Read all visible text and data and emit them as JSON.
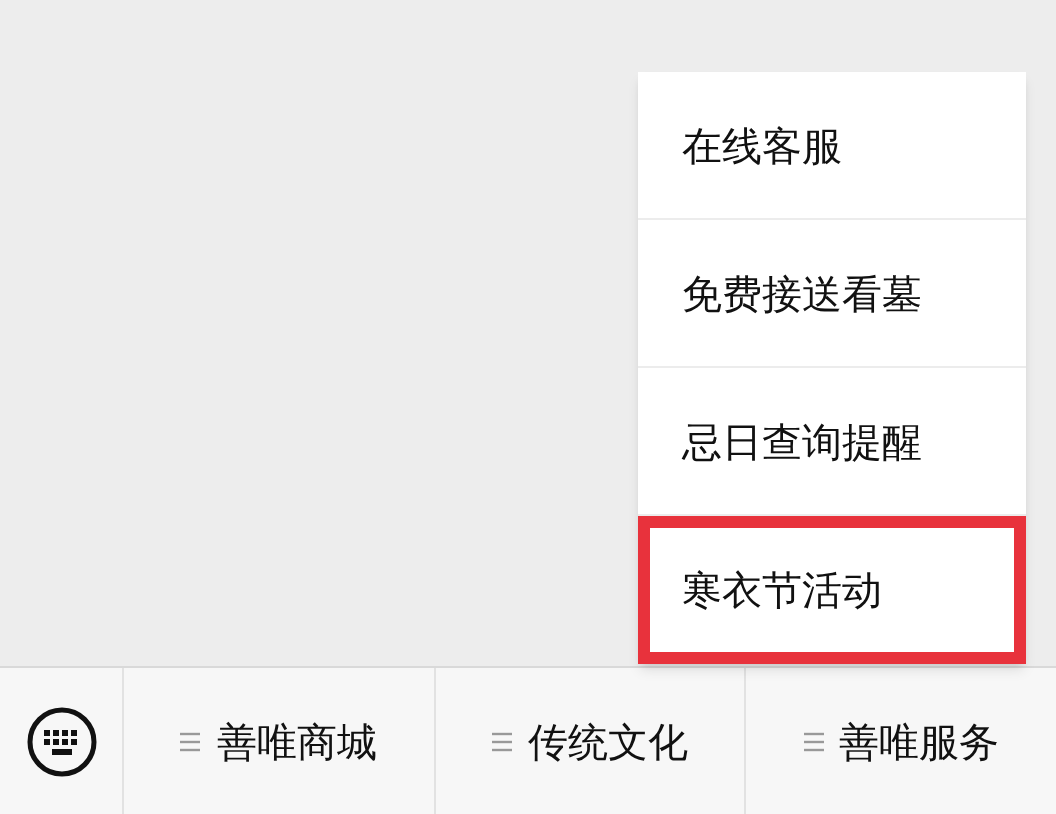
{
  "popup_menu": {
    "items": [
      {
        "label": "在线客服",
        "highlighted": false
      },
      {
        "label": "免费接送看墓",
        "highlighted": false
      },
      {
        "label": "忌日查询提醒",
        "highlighted": false
      },
      {
        "label": "寒衣节活动",
        "highlighted": true
      }
    ]
  },
  "bottom_menu": {
    "items": [
      {
        "label": "善唯商城"
      },
      {
        "label": "传统文化"
      },
      {
        "label": "善唯服务"
      }
    ]
  }
}
